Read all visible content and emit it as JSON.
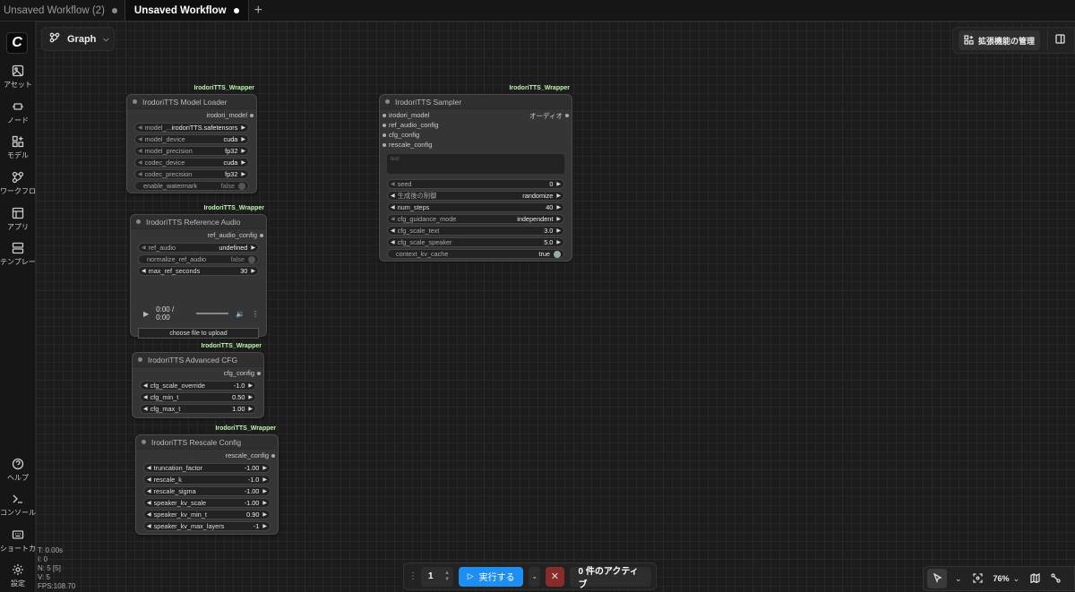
{
  "tabs": [
    {
      "label": "Unsaved Workflow (2)",
      "active": false
    },
    {
      "label": "Unsaved Workflow",
      "active": true
    }
  ],
  "new_tab_label": "+",
  "sidebar": {
    "logo": "C",
    "items": [
      {
        "label": "アセット",
        "icon": "image-icon"
      },
      {
        "label": "ノード",
        "icon": "node-icon"
      },
      {
        "label": "モデル",
        "icon": "model-icon"
      },
      {
        "label": "ワークフロー",
        "icon": "workflow-icon"
      },
      {
        "label": "アプリ",
        "icon": "app-icon"
      },
      {
        "label": "テンプレート",
        "icon": "template-icon"
      }
    ],
    "bottom_items": [
      {
        "label": "ヘルプ",
        "icon": "help-icon"
      },
      {
        "label": "コンソール",
        "icon": "console-icon"
      },
      {
        "label": "ショートカット",
        "icon": "keyboard-icon"
      },
      {
        "label": "設定",
        "icon": "gear-icon"
      }
    ]
  },
  "stats": [
    "T: 0.00s",
    "I: 0",
    "N: 5 [5]",
    "V: 5",
    "FPS:108.70"
  ],
  "graph_button": {
    "label": "Graph"
  },
  "extensions_button": {
    "label": "拡張機能の管理"
  },
  "nodes": {
    "model_loader": {
      "badge": "IrodoriTTS_Wrapper",
      "title": "IrodoriTTS Model Loader",
      "output": "irodori_model",
      "widgets": [
        {
          "name": "model_...",
          "value": "irodoriTTS.safetensors"
        },
        {
          "name": "model_device",
          "value": "cuda"
        },
        {
          "name": "model_precision",
          "value": "fp32"
        },
        {
          "name": "codec_device",
          "value": "cuda"
        },
        {
          "name": "codec_precision",
          "value": "fp32"
        }
      ],
      "toggle": {
        "name": "enable_watermark",
        "value": "false"
      }
    },
    "reference_audio": {
      "badge": "IrodoriTTS_Wrapper",
      "title": "IrodoriTTS Reference Audio",
      "output": "ref_audio_config",
      "widgets": [
        {
          "name": "ref_audio",
          "value": "undefined"
        }
      ],
      "toggle": {
        "name": "normalize_ref_audio",
        "value": "false"
      },
      "widgets2": [
        {
          "name": "max_ref_seconds",
          "value": "30"
        }
      ],
      "player_time": "0:00 / 0:00",
      "upload_label": "choose file to upload"
    },
    "advanced_cfg": {
      "badge": "IrodoriTTS_Wrapper",
      "title": "IrodoriTTS Advanced CFG",
      "output": "cfg_config",
      "widgets": [
        {
          "name": "cfg_scale_override",
          "value": "-1.0"
        },
        {
          "name": "cfg_min_t",
          "value": "0.50"
        },
        {
          "name": "cfg_max_t",
          "value": "1.00"
        }
      ]
    },
    "rescale_config": {
      "badge": "IrodoriTTS_Wrapper",
      "title": "IrodoriTTS Rescale Config",
      "output": "rescale_config",
      "widgets": [
        {
          "name": "truncation_factor",
          "value": "-1.00"
        },
        {
          "name": "rescale_k",
          "value": "-1.0"
        },
        {
          "name": "rescale_sigma",
          "value": "-1.00"
        },
        {
          "name": "speaker_kv_scale",
          "value": "-1.00"
        },
        {
          "name": "speaker_kv_min_t",
          "value": "0.90"
        },
        {
          "name": "speaker_kv_max_layers",
          "value": "-1"
        }
      ]
    },
    "sampler": {
      "badge": "IrodoriTTS_Wrapper",
      "title": "IrodoriTTS Sampler",
      "inputs": [
        "irodori_model",
        "ref_audio_config",
        "cfg_config",
        "rescale_config"
      ],
      "output": "オーディオ",
      "text_placeholder": "text",
      "widgets": [
        {
          "name": "seed",
          "value": "0"
        },
        {
          "name": "生成後の制御",
          "value": "randomize"
        },
        {
          "name": "num_steps",
          "value": "40"
        },
        {
          "name": "cfg_guidance_mode",
          "value": "independent"
        },
        {
          "name": "cfg_scale_text",
          "value": "3.0"
        },
        {
          "name": "cfg_scale_speaker",
          "value": "5.0"
        }
      ],
      "toggle": {
        "name": "context_kv_cache",
        "value": "true"
      }
    }
  },
  "runbar": {
    "quantity": "1",
    "run_label": "実行する",
    "cancel_icon": "close-icon",
    "active_label": "0 件のアクティブ"
  },
  "bottom_right": {
    "zoom": "76%"
  }
}
